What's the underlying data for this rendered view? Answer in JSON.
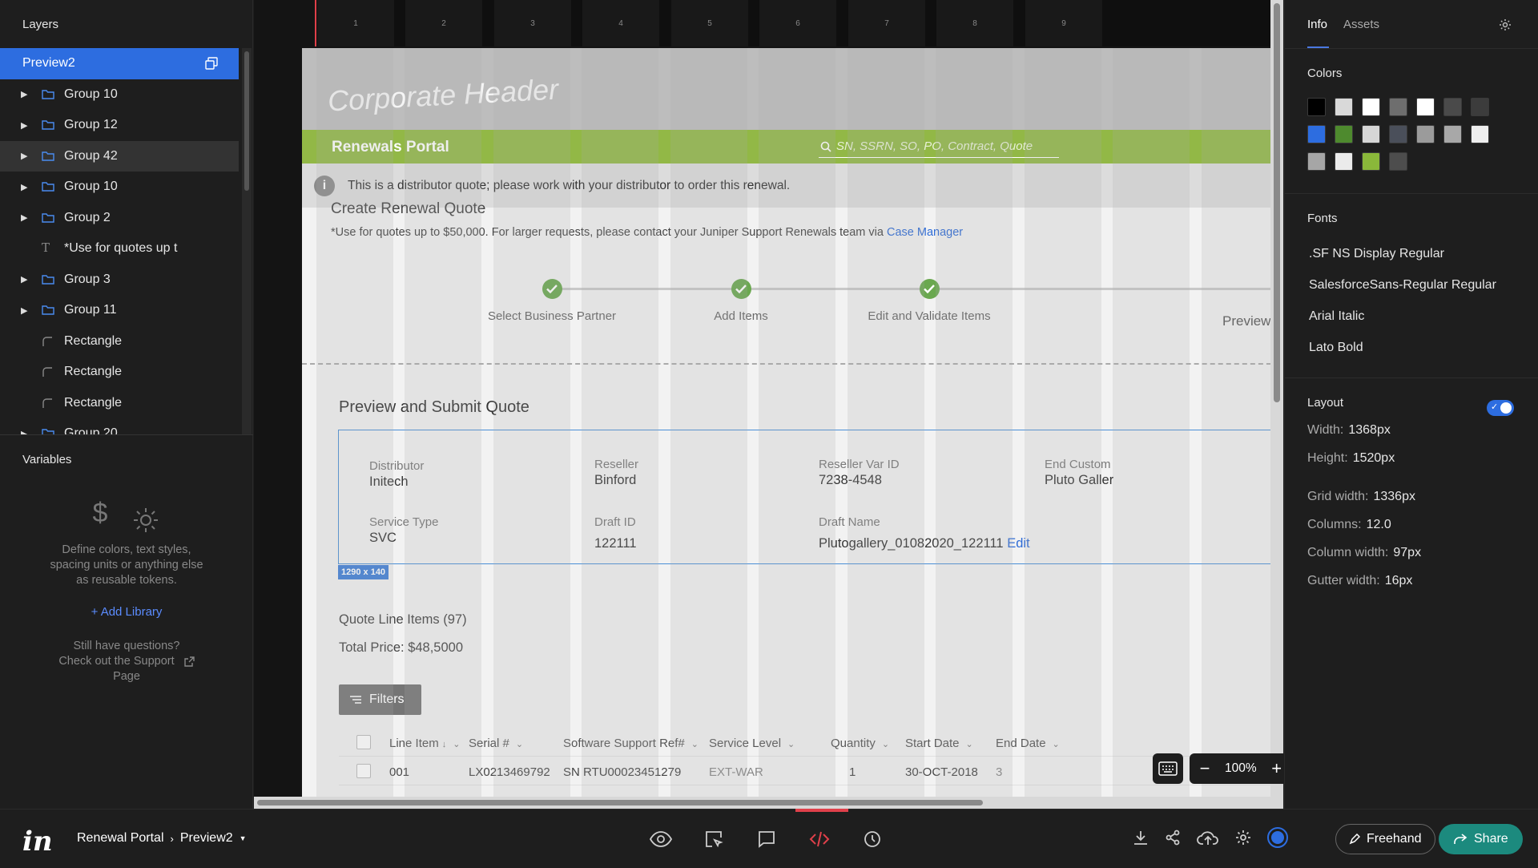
{
  "left_panel": {
    "layers_title": "Layers",
    "selected_layer": "Preview2",
    "layers": [
      {
        "label": "Group 10",
        "type": "group"
      },
      {
        "label": "Group 12",
        "type": "group"
      },
      {
        "label": "Group 42",
        "type": "group",
        "highlight": true
      },
      {
        "label": "Group 10",
        "type": "group"
      },
      {
        "label": "Group 2",
        "type": "group"
      },
      {
        "label": "*Use for quotes up t",
        "type": "text"
      },
      {
        "label": "Group 3",
        "type": "group"
      },
      {
        "label": "Group 11",
        "type": "group"
      },
      {
        "label": "Rectangle",
        "type": "shape"
      },
      {
        "label": "Rectangle",
        "type": "shape"
      },
      {
        "label": "Rectangle",
        "type": "shape"
      },
      {
        "label": "Group 20",
        "type": "group"
      }
    ],
    "variables": {
      "title": "Variables",
      "description_1": "Define colors, text styles,",
      "description_2": "spacing units or anything else",
      "description_3": "as reusable tokens.",
      "add_library": "+ Add Library",
      "help_1": "Still have questions?",
      "help_2": "Check out the Support",
      "help_3": "Page"
    }
  },
  "canvas": {
    "ruler_columns": [
      "1",
      "2",
      "3",
      "4",
      "5",
      "6",
      "7",
      "8",
      "9"
    ],
    "corporate_header": "Corporate Header",
    "portal_title": "Renewals Portal",
    "search_placeholder": "SN, SSRN, SO, PO, Contract, Quote",
    "notice": "This is a distributor quote; please work with your distributor to order this renewal.",
    "create_title": "Create Renewal Quote",
    "create_note": "*Use for quotes up to $50,000. For larger requests, please contact your Juniper Support Renewals team via",
    "case_manager": "Case Manager",
    "steps": [
      "Select Business Partner",
      "Add Items",
      "Edit and Validate Items"
    ],
    "step_preview": "Preview",
    "section_title": "Preview and Submit Quote",
    "summary": {
      "distributor_label": "Distributor",
      "distributor": "Initech",
      "reseller_label": "Reseller",
      "reseller": "Binford",
      "reseller_var_label": "Reseller Var ID",
      "reseller_var": "7238-4548",
      "end_customer_label": "End Custom",
      "end_customer": "Pluto Galler",
      "service_type_label": "Service Type",
      "service_type": "SVC",
      "draft_id_label": "Draft ID",
      "draft_id": "122111",
      "draft_name_label": "Draft Name",
      "draft_name": "Plutogallery_01082020_122111",
      "edit": "Edit"
    },
    "size_tag": "1290 x 140",
    "line_items": "Quote Line Items (97)",
    "total_price": "Total Price:  $48,5000",
    "filters": "Filters",
    "table": {
      "headers": [
        "Line Item",
        "Serial #",
        "Software Support Ref#",
        "Service Level",
        "Quantity",
        "Start Date",
        "End Date"
      ],
      "rows": [
        [
          "001",
          "LX0213469792",
          "SN RTU00023451279",
          "EXT-WAR",
          "1",
          "30-OCT-2018",
          "3"
        ]
      ]
    },
    "zoom": "100%"
  },
  "right_panel": {
    "tabs": [
      "Info",
      "Assets"
    ],
    "colors_title": "Colors",
    "colors": [
      "#000000",
      "#d9d9d9",
      "#ffffff",
      "#6e6e6e",
      "#ffffff",
      "#4a4a4a",
      "#3c3c3c",
      "#2d6de0",
      "#4e8a2e",
      "#d6d6d6",
      "#4a4f5a",
      "#9b9b9b",
      "#a8a8a8",
      "#eeeeee",
      "#a6a6a6",
      "#ebebeb",
      "#8ab83a",
      "#4d4d4d"
    ],
    "fonts_title": "Fonts",
    "fonts": [
      ".SF NS Display Regular",
      "SalesforceSans-Regular Regular",
      "Arial Italic",
      "Lato Bold"
    ],
    "layout_title": "Layout",
    "layout": [
      {
        "label": "Width:",
        "value": "1368px"
      },
      {
        "label": "Height:",
        "value": "1520px"
      },
      {
        "label": "Grid width:",
        "value": "1336px"
      },
      {
        "label": "Columns:",
        "value": "12.0"
      },
      {
        "label": "Column width:",
        "value": "97px"
      },
      {
        "label": "Gutter width:",
        "value": "16px"
      }
    ]
  },
  "bottom_bar": {
    "project": "Renewal Portal",
    "screen": "Preview2",
    "freehand": "Freehand",
    "share": "Share"
  }
}
